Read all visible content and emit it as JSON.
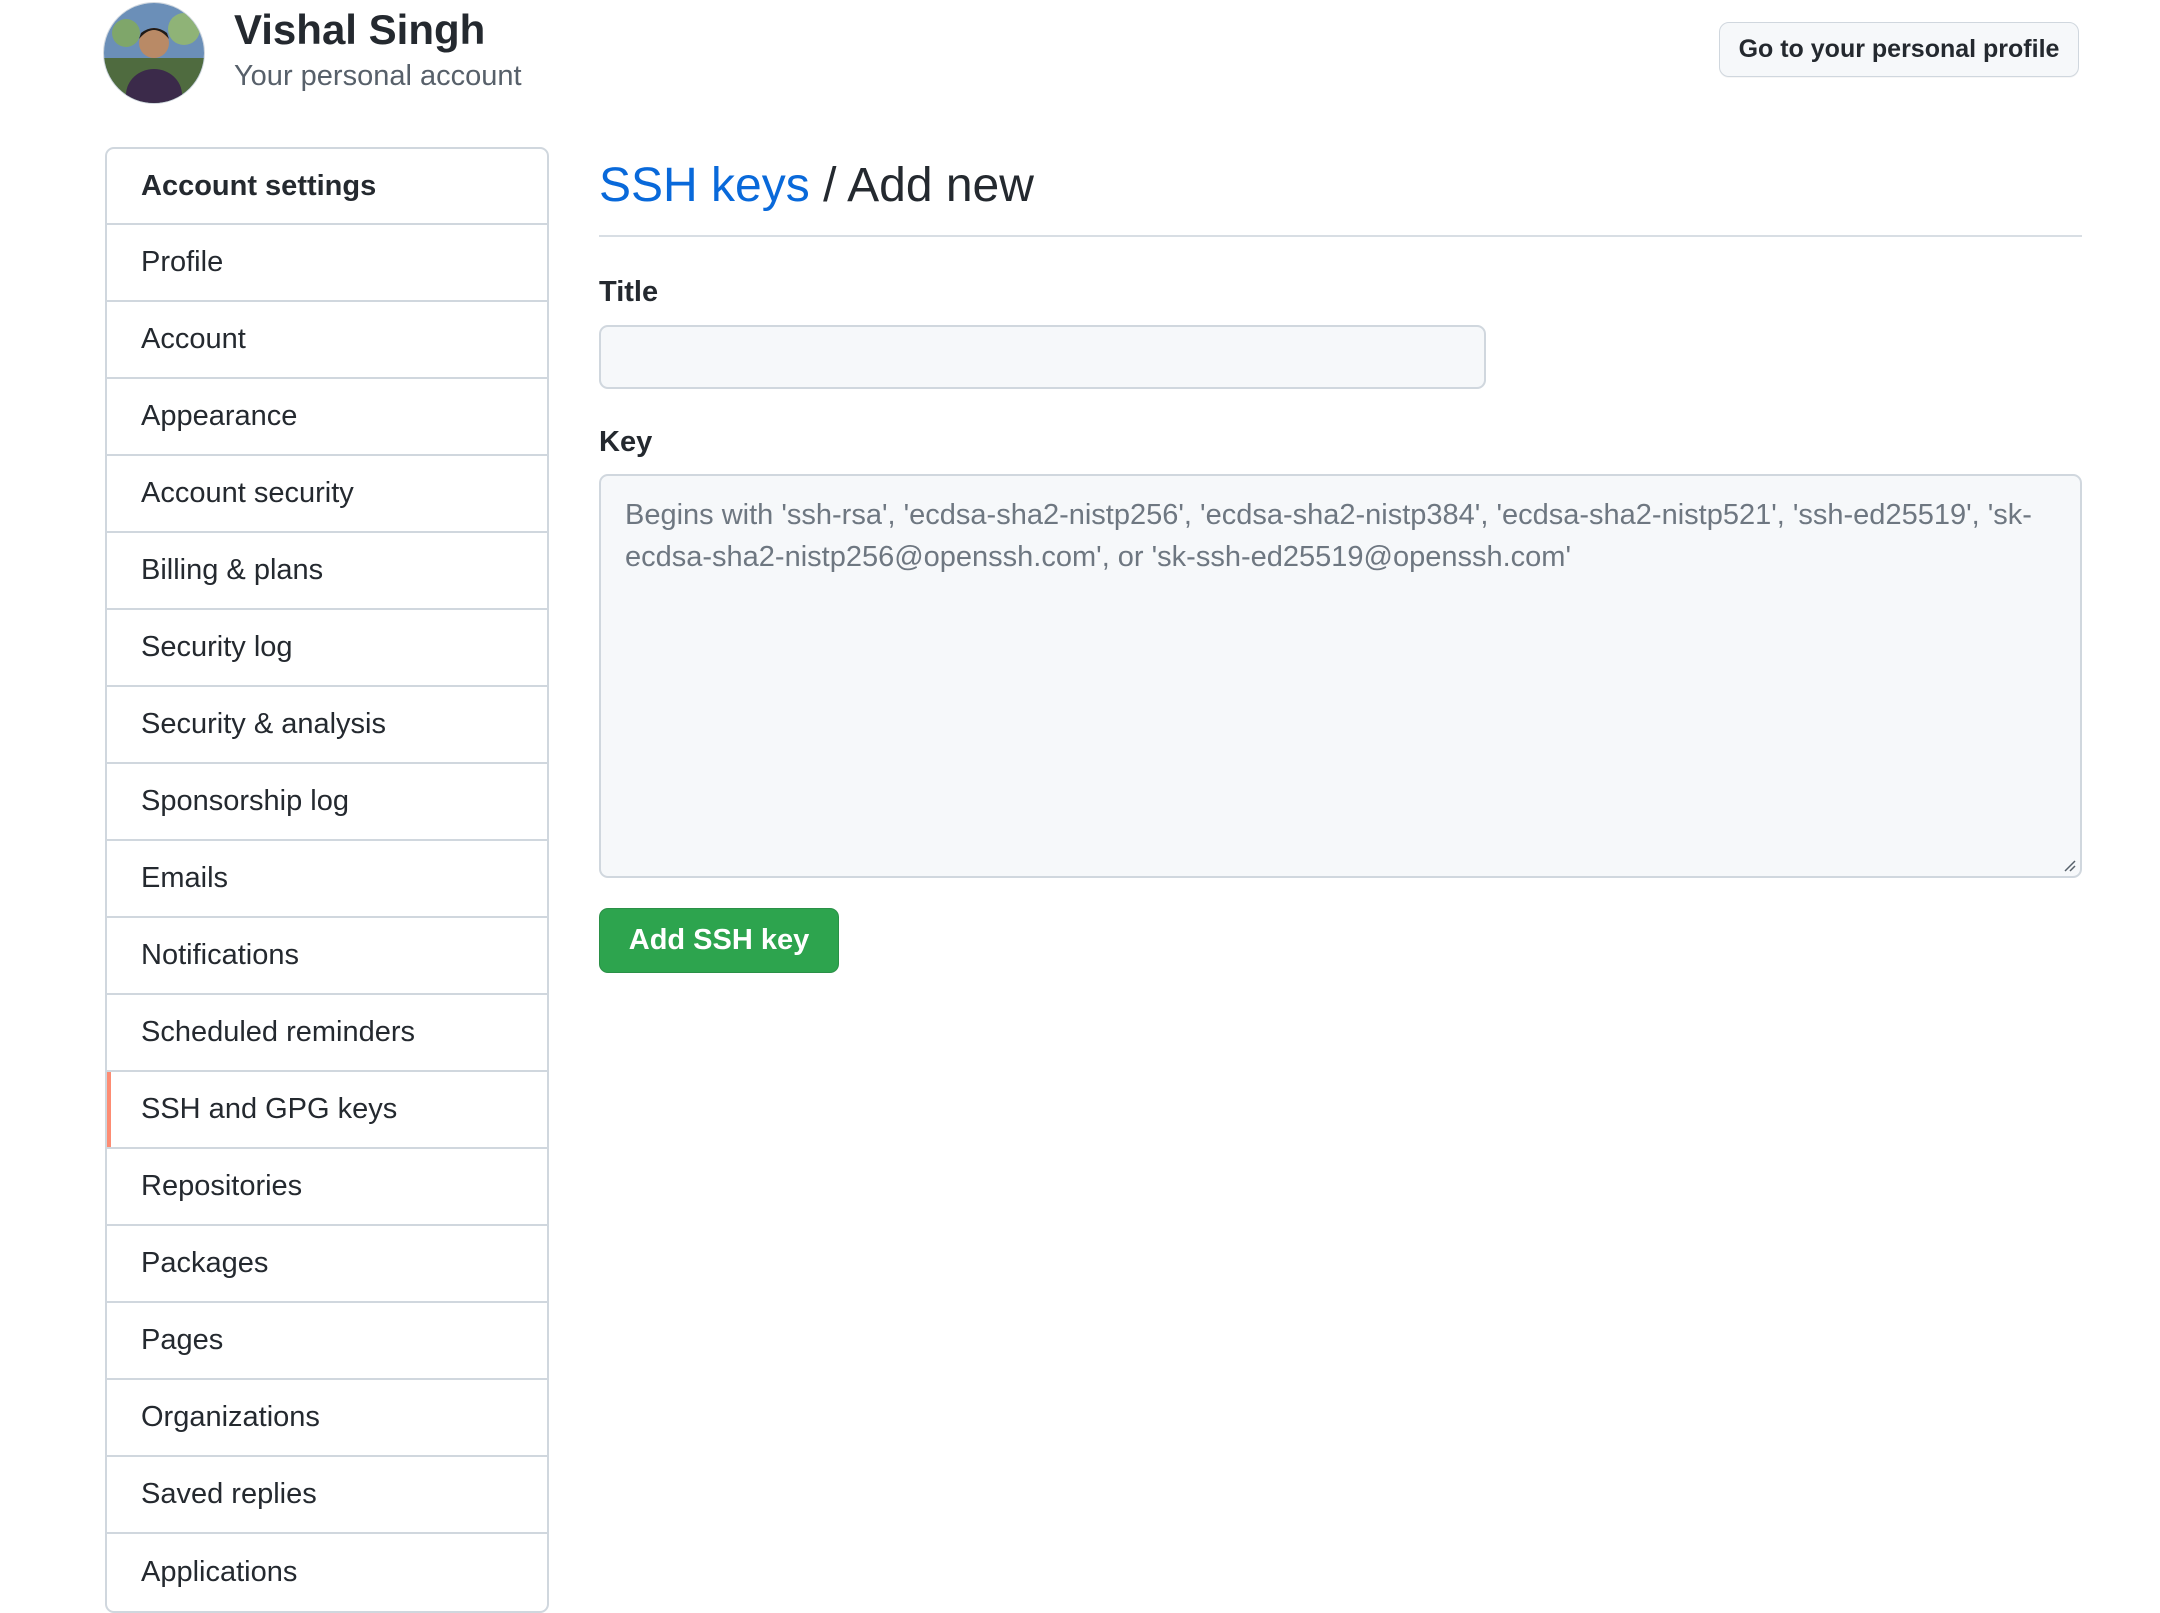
{
  "header": {
    "user_name": "Vishal Singh",
    "account_type": "Your personal account",
    "profile_button_label": "Go to your personal profile"
  },
  "sidebar": {
    "heading": "Account settings",
    "active_item": "SSH and GPG keys",
    "active_color": "#fd8c73",
    "items": [
      {
        "label": "Profile"
      },
      {
        "label": "Account"
      },
      {
        "label": "Appearance"
      },
      {
        "label": "Account security"
      },
      {
        "label": "Billing & plans"
      },
      {
        "label": "Security log"
      },
      {
        "label": "Security & analysis"
      },
      {
        "label": "Sponsorship log"
      },
      {
        "label": "Emails"
      },
      {
        "label": "Notifications"
      },
      {
        "label": "Scheduled reminders"
      },
      {
        "label": "SSH and GPG keys"
      },
      {
        "label": "Repositories"
      },
      {
        "label": "Packages"
      },
      {
        "label": "Pages"
      },
      {
        "label": "Organizations"
      },
      {
        "label": "Saved replies"
      },
      {
        "label": "Applications"
      }
    ]
  },
  "main": {
    "breadcrumb_link": "SSH keys",
    "breadcrumb_separator": "/",
    "breadcrumb_current": "Add new",
    "title_field": {
      "label": "Title",
      "value": ""
    },
    "key_field": {
      "label": "Key",
      "value": "",
      "placeholder": "Begins with 'ssh-rsa', 'ecdsa-sha2-nistp256', 'ecdsa-sha2-nistp384', 'ecdsa-sha2-nistp521', 'ssh-ed25519', 'sk-ecdsa-sha2-nistp256@openssh.com', or 'sk-ssh-ed25519@openssh.com'"
    },
    "submit_label": "Add SSH key",
    "colors": {
      "link": "#0969da",
      "primary_button": "#2da44e"
    }
  }
}
